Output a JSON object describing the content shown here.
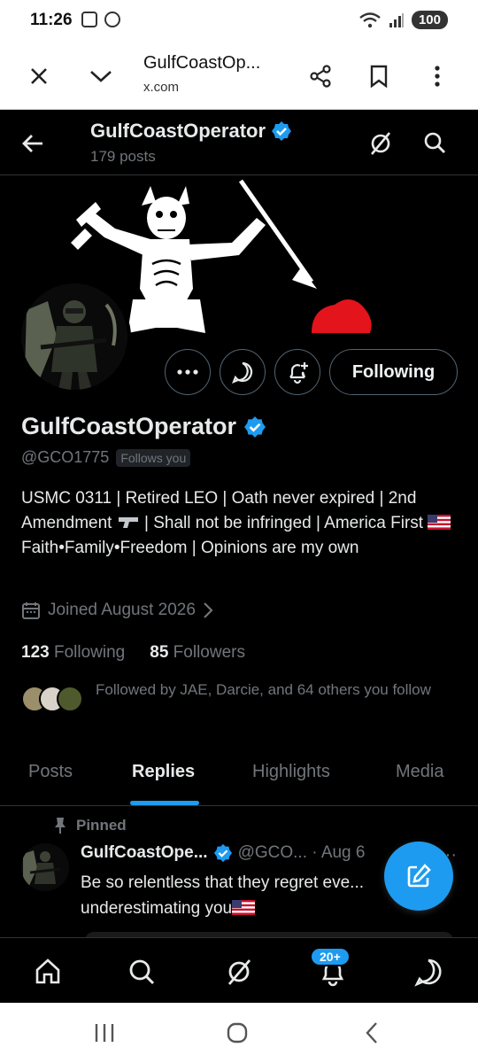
{
  "status_bar": {
    "time": "11:26",
    "battery": "100"
  },
  "browser": {
    "title": "GulfCoastOp...",
    "url": "x.com"
  },
  "header": {
    "name": "GulfCoastOperator",
    "posts": "179 posts"
  },
  "profile": {
    "name": "GulfCoastOperator",
    "handle": "@GCO1775",
    "follows_you": "Follows you",
    "bio_line1": "USMC 0311 | Retired LEO | Oath never expired | 2nd Amendment ",
    "bio_line2": " | Shall not be infringed | America First ",
    "bio_line3": " Faith•Family•Freedom | Opinions are my own",
    "joined": "Joined August 2026",
    "following_count": "123",
    "following_label": "Following",
    "followers_count": "85",
    "followers_label": "Followers",
    "followed_by": "Followed by JAE, Darcie, and 64 others you follow",
    "follow_button": "Following"
  },
  "tabs": [
    {
      "label": "Posts"
    },
    {
      "label": "Replies"
    },
    {
      "label": "Highlights"
    },
    {
      "label": "Media"
    }
  ],
  "pinned_tweet": {
    "pinned_label": "Pinned",
    "name": "GulfCoastOpe...",
    "meta": "@GCO... · Aug 6",
    "text": "Be so relentless that they regret eve... underestimating you"
  },
  "bottom_nav": {
    "notifications_badge": "20+"
  },
  "colors": {
    "accent": "#1d9bf0",
    "background": "#000000",
    "muted": "#71767b"
  }
}
